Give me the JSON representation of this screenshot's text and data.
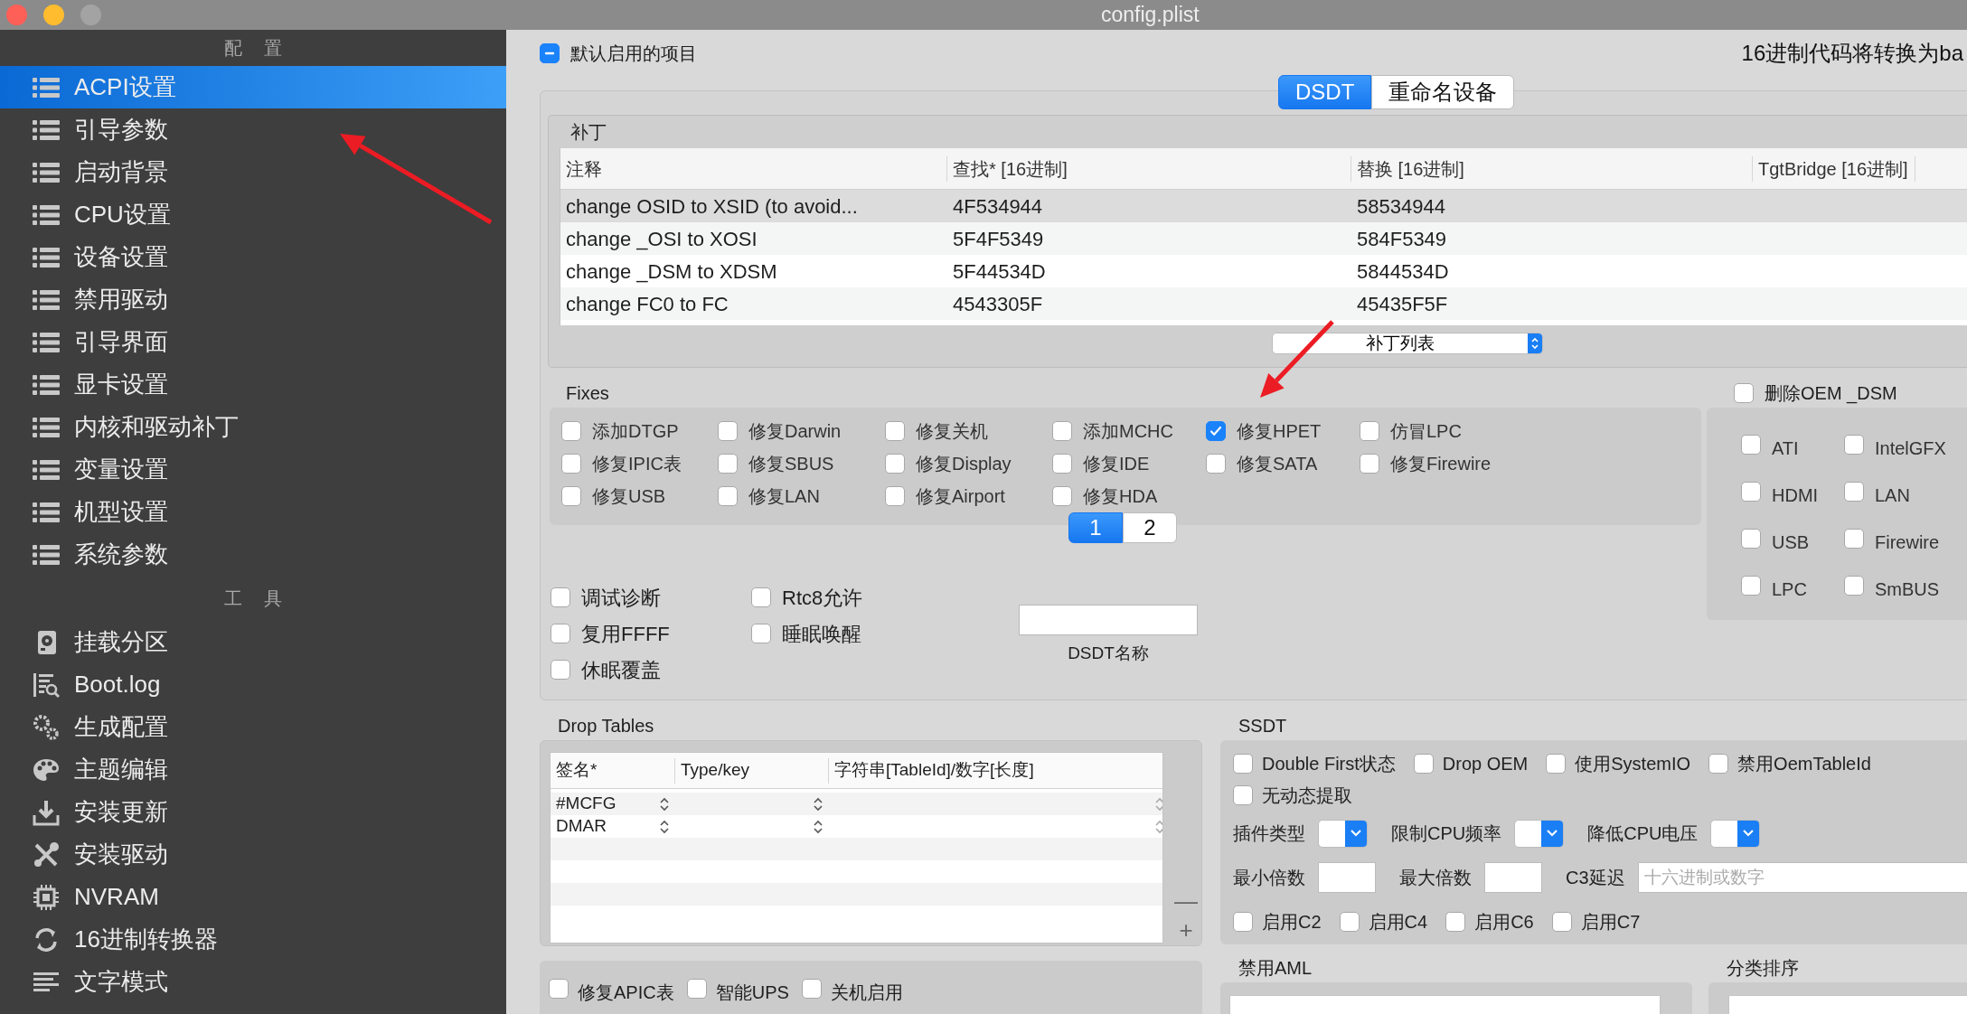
{
  "window": {
    "title": "config.plist"
  },
  "sidebar": {
    "sections": [
      {
        "header": "配 置",
        "items": [
          {
            "label": "ACPI设置",
            "kind": "list",
            "selected": true
          },
          {
            "label": "引导参数",
            "kind": "list",
            "selected": false
          },
          {
            "label": "启动背景",
            "kind": "list",
            "selected": false
          },
          {
            "label": "CPU设置",
            "kind": "list",
            "selected": false
          },
          {
            "label": "设备设置",
            "kind": "list",
            "selected": false
          },
          {
            "label": "禁用驱动",
            "kind": "list",
            "selected": false
          },
          {
            "label": "引导界面",
            "kind": "list",
            "selected": false
          },
          {
            "label": "显卡设置",
            "kind": "list",
            "selected": false
          },
          {
            "label": "内核和驱动补丁",
            "kind": "list",
            "selected": false
          },
          {
            "label": "变量设置",
            "kind": "list",
            "selected": false
          },
          {
            "label": "机型设置",
            "kind": "list",
            "selected": false
          },
          {
            "label": "系统参数",
            "kind": "list",
            "selected": false
          }
        ]
      },
      {
        "header": "工 具",
        "items": [
          {
            "label": "挂载分区",
            "kind": "disk",
            "selected": false
          },
          {
            "label": "Boot.log",
            "kind": "log",
            "selected": false
          },
          {
            "label": "生成配置",
            "kind": "gears",
            "selected": false
          },
          {
            "label": "主题编辑",
            "kind": "palette",
            "selected": false
          },
          {
            "label": "安装更新",
            "kind": "download",
            "selected": false
          },
          {
            "label": "安装驱动",
            "kind": "tools",
            "selected": false
          },
          {
            "label": "NVRAM",
            "kind": "chip",
            "selected": false
          },
          {
            "label": "16进制转换器",
            "kind": "refresh",
            "selected": false
          },
          {
            "label": "文字模式",
            "kind": "text",
            "selected": false
          }
        ]
      }
    ]
  },
  "enable_default": {
    "label": "默认启用的项目",
    "indeterminate": true
  },
  "hex_note": "16进制代码将转换为ba",
  "segments": [
    {
      "label": "DSDT",
      "selected": true
    },
    {
      "label": "重命名设备",
      "selected": false
    }
  ],
  "patches": {
    "title": "补丁",
    "columns": [
      "注释",
      "查找* [16进制]",
      "替换 [16进制]",
      "TgtBridge [16进制]"
    ],
    "rows": [
      {
        "cells": [
          "change OSID to XSID (to avoid...",
          "4F534944",
          "58534944"
        ],
        "selected": true
      },
      {
        "cells": [
          "change _OSI to XOSI",
          "5F4F5349",
          "584F5349"
        ],
        "selected": false
      },
      {
        "cells": [
          "change _DSM to XDSM",
          "5F44534D",
          "5844534D"
        ],
        "selected": false
      },
      {
        "cells": [
          "change FC0 to FC",
          "4543305F",
          "45435F5F"
        ],
        "selected": false
      }
    ],
    "popup": "补丁列表"
  },
  "fixes": {
    "title": "Fixes",
    "items": [
      {
        "label": "添加DTGP",
        "checked": false
      },
      {
        "label": "修复Darwin",
        "checked": false
      },
      {
        "label": "修复关机",
        "checked": false
      },
      {
        "label": "添加MCHC",
        "checked": false
      },
      {
        "label": "修复HPET",
        "checked": true
      },
      {
        "label": "仿冒LPC",
        "checked": false
      },
      {
        "label": "修复IPIC表",
        "checked": false
      },
      {
        "label": "修复SBUS",
        "checked": false
      },
      {
        "label": "修复Display",
        "checked": false
      },
      {
        "label": "修复IDE",
        "checked": false
      },
      {
        "label": "修复SATA",
        "checked": false
      },
      {
        "label": "修复Firewire",
        "checked": false
      },
      {
        "label": "修复USB",
        "checked": false
      },
      {
        "label": "修复LAN",
        "checked": false
      },
      {
        "label": "修复Airport",
        "checked": false
      },
      {
        "label": "修复HDA",
        "checked": false
      }
    ],
    "pages": [
      {
        "label": "1",
        "selected": true
      },
      {
        "label": "2",
        "selected": false
      }
    ]
  },
  "drop_oem_dsm": {
    "label": "删除OEM _DSM",
    "checked": false,
    "items": [
      {
        "label": "ATI",
        "checked": false
      },
      {
        "label": "IntelGFX",
        "checked": false
      },
      {
        "label": "HDMI",
        "checked": false
      },
      {
        "label": "LAN",
        "checked": false
      },
      {
        "label": "USB",
        "checked": false
      },
      {
        "label": "Firewire",
        "checked": false
      },
      {
        "label": "LPC",
        "checked": false
      },
      {
        "label": "SmBUS",
        "checked": false
      }
    ]
  },
  "options": [
    {
      "label": "调试诊断",
      "checked": false
    },
    {
      "label": "复用FFFF",
      "checked": false
    },
    {
      "label": "休眠覆盖",
      "checked": false
    },
    {
      "label": "Rtc8允许",
      "checked": false
    },
    {
      "label": "睡眠唤醒",
      "checked": false
    }
  ],
  "dsdt_name": {
    "label": "DSDT名称"
  },
  "drop_tables": {
    "title": "Drop Tables",
    "columns": [
      "签名*",
      "Type/key",
      "字符串[TableId]/数字[长度]"
    ],
    "rows": [
      {
        "signature": "#MCFG"
      },
      {
        "signature": "DMAR"
      }
    ],
    "buttons": [
      "—",
      "+"
    ]
  },
  "bottom_checks": [
    {
      "label": "修复APIC表",
      "checked": false
    },
    {
      "label": "智能UPS",
      "checked": false
    },
    {
      "label": "关机启用",
      "checked": false
    }
  ],
  "ssdt": {
    "title": "SSDT",
    "checks": [
      {
        "label": "Double First状态",
        "checked": false
      },
      {
        "label": "Drop OEM",
        "checked": false
      },
      {
        "label": "使用SystemIO",
        "checked": false
      },
      {
        "label": "禁用OemTableId",
        "checked": false
      },
      {
        "label": "无动态提取",
        "checked": false
      }
    ],
    "selects": [
      {
        "label": "插件类型"
      },
      {
        "label": "限制CPU频率"
      },
      {
        "label": "降低CPU电压"
      }
    ],
    "fields": [
      {
        "label": "最小倍数"
      },
      {
        "label": "最大倍数"
      },
      {
        "label": "C3延迟",
        "placeholder": "十六进制或数字"
      }
    ],
    "c_states": [
      {
        "label": "启用C2",
        "checked": false
      },
      {
        "label": "启用C4",
        "checked": false
      },
      {
        "label": "启用C6",
        "checked": false
      },
      {
        "label": "启用C7",
        "checked": false
      }
    ]
  },
  "disable_aml": {
    "title": "禁用AML"
  },
  "sort_order": {
    "title": "分类排序"
  }
}
